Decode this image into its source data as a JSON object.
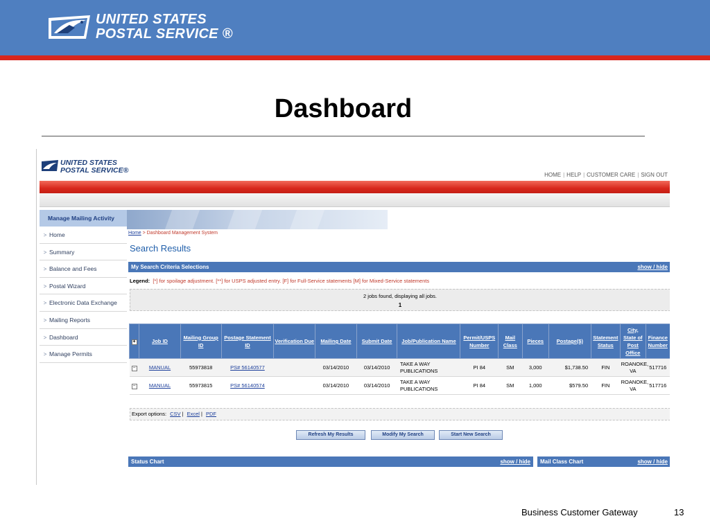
{
  "slide": {
    "logo_line1": "UNITED STATES",
    "logo_line2": "POSTAL SERVICE ®",
    "title": "Dashboard",
    "footer_text": "Business Customer Gateway",
    "page_number": "13"
  },
  "app": {
    "logo_line1": "UNITED STATES",
    "logo_line2": "POSTAL SERVICE®",
    "toplinks": [
      "HOME",
      "HELP",
      "CUSTOMER CARE",
      "SIGN OUT"
    ]
  },
  "sidebar": {
    "title": "Manage Mailing Activity",
    "items": [
      {
        "label": "Home"
      },
      {
        "label": "Summary"
      },
      {
        "label": "Balance and Fees"
      },
      {
        "label": "Postal Wizard"
      },
      {
        "label": "Electronic Data Exchange"
      },
      {
        "label": "Mailing Reports"
      },
      {
        "label": "Dashboard"
      },
      {
        "label": "Manage Permits"
      }
    ]
  },
  "breadcrumb": {
    "home": "Home",
    "rest": " > Dashboard Management System"
  },
  "search": {
    "heading": "Search Results",
    "criteria_title": "My Search Criteria Selections",
    "show_hide": "show / hide",
    "legend_label": "Legend:",
    "legend_text": "[*] for spoilage adjustment.     [**] for USPS adjusted entry.     [F] for Full-Service statements     [M] for Mixed-Service statements",
    "jobs_found": "2 jobs found, displaying all jobs.",
    "page": "1"
  },
  "table": {
    "headers": {
      "job_id": "Job ID",
      "mailing_group_id": "Mailing Group ID",
      "postage_statement_id": "Postage Statement ID",
      "verification_due": "Verification Due",
      "mailing_date": "Mailing Date",
      "submit_date": "Submit Date",
      "job_publication_name": "Job/Publication Name",
      "permit_usps_number": "Permit/USPS Number",
      "mail_class": "Mail Class",
      "pieces": "Pieces",
      "postage": "Postage($)",
      "statement_status": "Statement Status",
      "city_state_po": "City, State of Post Office",
      "finance_number": "Finance Number"
    },
    "rows": [
      {
        "job_id": "MANUAL",
        "mailing_group_id": "55973818",
        "postage_statement_id": "PS# 56140577",
        "verification_due": "",
        "mailing_date": "03/14/2010",
        "submit_date": "03/14/2010",
        "job_publication_name": "TAKE A WAY PUBLICATIONS",
        "permit_usps_number": "PI 84",
        "mail_class": "SM",
        "pieces": "3,000",
        "postage": "$1,738.50",
        "statement_status": "FIN",
        "city_state_po": "ROANOKE, VA",
        "finance_number": "517716"
      },
      {
        "job_id": "MANUAL",
        "mailing_group_id": "55973815",
        "postage_statement_id": "PS# 56140574",
        "verification_due": "",
        "mailing_date": "03/14/2010",
        "submit_date": "03/14/2010",
        "job_publication_name": "TAKE A WAY PUBLICATIONS",
        "permit_usps_number": "PI 84",
        "mail_class": "SM",
        "pieces": "1,000",
        "postage": "$579.50",
        "statement_status": "FIN",
        "city_state_po": "ROANOKE, VA",
        "finance_number": "517716"
      }
    ]
  },
  "export": {
    "label": "Export options:",
    "options": [
      "CSV",
      "Excel",
      "PDF"
    ]
  },
  "buttons": {
    "refresh": "Refresh My Results",
    "modify": "Modify My Search",
    "new_search": "Start New Search"
  },
  "charts": {
    "status_chart": "Status Chart",
    "mail_class_chart": "Mail Class Chart",
    "show_hide": "show / hide"
  },
  "colors": {
    "slide_header": "#4f7fc0",
    "slide_stripe": "#d9261c",
    "table_header": "#4a77b8",
    "link": "#1a3d9a"
  }
}
